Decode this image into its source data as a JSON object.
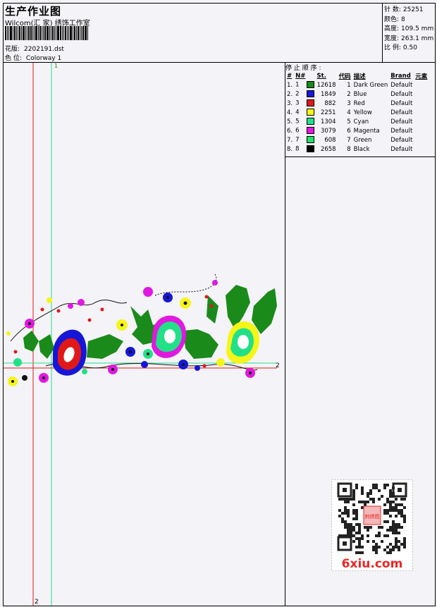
{
  "header": {
    "title": "生产作业图",
    "studio": "Wilcom(汇 家) 绣饰工作室",
    "pattern_label": "花版:",
    "pattern_value": "2202191.dst",
    "colorway_label": "色 位:",
    "colorway_value": "Colorway 1"
  },
  "stats": [
    {
      "label": "针 数:",
      "value": "25251"
    },
    {
      "label": "颜色:",
      "value": "8"
    },
    {
      "label": "高度:",
      "value": "109.5 mm"
    },
    {
      "label": "宽度:",
      "value": "263.1 mm"
    },
    {
      "label": "比 例:",
      "value": "0.50"
    }
  ],
  "stop_sequence": {
    "title": "停 止 顺 序 :",
    "columns": [
      "#",
      "N#",
      "St.",
      "代码",
      "描述",
      "Brand",
      "元素"
    ],
    "rows": [
      {
        "idx": "1.",
        "n": "1",
        "color": "#1a8a1a",
        "st": "12618",
        "code": "1",
        "desc": "Dark Green",
        "brand": "Default"
      },
      {
        "idx": "2.",
        "n": "2",
        "color": "#1616d8",
        "st": "1849",
        "code": "2",
        "desc": "Blue",
        "brand": "Default"
      },
      {
        "idx": "3.",
        "n": "3",
        "color": "#e01818",
        "st": "882",
        "code": "3",
        "desc": "Red",
        "brand": "Default"
      },
      {
        "idx": "4.",
        "n": "4",
        "color": "#f5f518",
        "st": "2251",
        "code": "4",
        "desc": "Yellow",
        "brand": "Default"
      },
      {
        "idx": "5.",
        "n": "5",
        "color": "#22e088",
        "st": "1304",
        "code": "5",
        "desc": "Cyan",
        "brand": "Default"
      },
      {
        "idx": "6.",
        "n": "6",
        "color": "#e018e0",
        "st": "3079",
        "code": "6",
        "desc": "Magenta",
        "brand": "Default"
      },
      {
        "idx": "7.",
        "n": "7",
        "color": "#22e06a",
        "st": "608",
        "code": "7",
        "desc": "Green",
        "brand": "Default"
      },
      {
        "idx": "8.",
        "n": "8",
        "color": "#000000",
        "st": "2658",
        "code": "8",
        "desc": "Black",
        "brand": "Default"
      }
    ]
  },
  "guides": {
    "mark_1": "1",
    "mark_2": "2"
  },
  "watermark": {
    "text": "6xiu.com",
    "seal": "刺绣图"
  },
  "colors": {
    "guide_red": "#e01818",
    "guide_green": "#22e088",
    "watermark": "#e82828"
  }
}
